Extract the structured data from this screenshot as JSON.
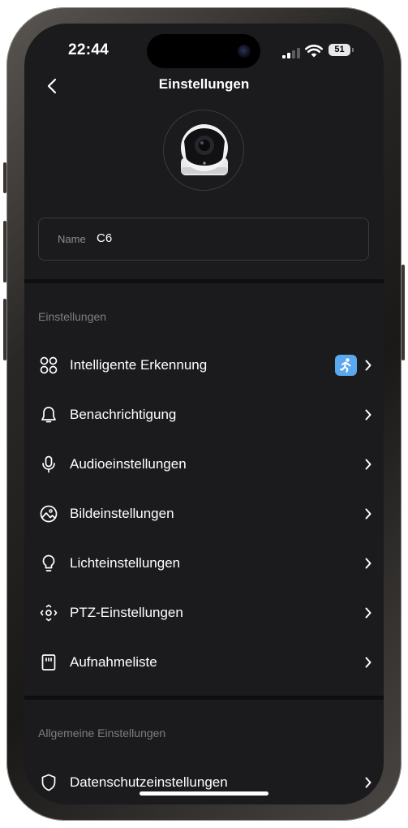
{
  "status_bar": {
    "time": "22:44",
    "battery": "51"
  },
  "header": {
    "title": "Einstellungen",
    "back_icon": "chevron-left-icon"
  },
  "device": {
    "image_icon": "camera-icon",
    "name_label": "Name",
    "name_value": "C6"
  },
  "sections": {
    "settings": {
      "title": "Einstellungen",
      "items": [
        {
          "label": "Intelligente Erkennung",
          "icon": "grid-circles-icon",
          "badge_icon": "person-running-icon",
          "badge_color": "#5aa8f0"
        },
        {
          "label": "Benachrichtigung",
          "icon": "bell-icon"
        },
        {
          "label": "Audioeinstellungen",
          "icon": "microphone-icon"
        },
        {
          "label": "Bildeinstellungen",
          "icon": "image-icon"
        },
        {
          "label": "Lichteinstellungen",
          "icon": "lightbulb-icon"
        },
        {
          "label": "PTZ-Einstellungen",
          "icon": "ptz-icon"
        },
        {
          "label": "Aufnahmeliste",
          "icon": "sd-card-icon"
        }
      ]
    },
    "general": {
      "title": "Allgemeine Einstellungen",
      "items": [
        {
          "label": "Datenschutzeinstellungen",
          "icon": "shield-icon"
        }
      ]
    }
  },
  "colors": {
    "background": "#1b1b1d",
    "text": "#ffffff",
    "muted_text": "#7e7e83",
    "accent": "#5aa8f0"
  }
}
